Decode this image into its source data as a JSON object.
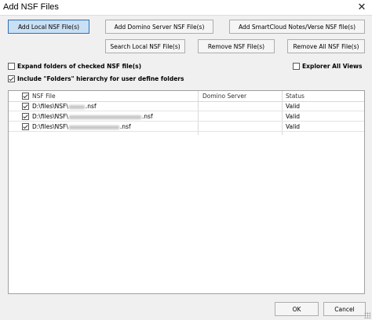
{
  "window": {
    "title": "Add NSF Files",
    "close_glyph": "✕"
  },
  "toolbar": {
    "add_local": "Add Local NSF File(s)",
    "add_domino": "Add Domino Server NSF File(s)",
    "add_smartcloud": "Add SmartCloud Notes/Verse NSF file(s)",
    "search_local": "Search Local NSF File(s)",
    "remove": "Remove NSF File(s)",
    "remove_all": "Remove All NSF File(s)"
  },
  "options": {
    "expand_folders": {
      "label": "Expand folders of checked NSF file(s)",
      "checked": false
    },
    "explorer_all_views": {
      "label": "Explorer All Views",
      "checked": false
    },
    "include_folders": {
      "label": "Include \"Folders\" hierarchy for user define folders",
      "checked": true
    }
  },
  "table": {
    "header_checked": true,
    "columns": [
      "NSF File",
      "Domino Server",
      "Status"
    ],
    "rows": [
      {
        "checked": true,
        "file_prefix": "D:\\files\\NSF\\",
        "file_suffix": ".nsf",
        "server": "",
        "status": "Valid"
      },
      {
        "checked": true,
        "file_prefix": "D:\\files\\NSF\\",
        "file_suffix": ".nsf",
        "server": "",
        "status": "Valid"
      },
      {
        "checked": true,
        "file_prefix": "D:\\files\\NSF\\",
        "file_suffix": ".nsf",
        "server": "",
        "status": "Valid"
      }
    ]
  },
  "footer": {
    "ok": "OK",
    "cancel": "Cancel"
  },
  "icons": {
    "close": "close-icon",
    "resize": "resize-grip-icon"
  }
}
